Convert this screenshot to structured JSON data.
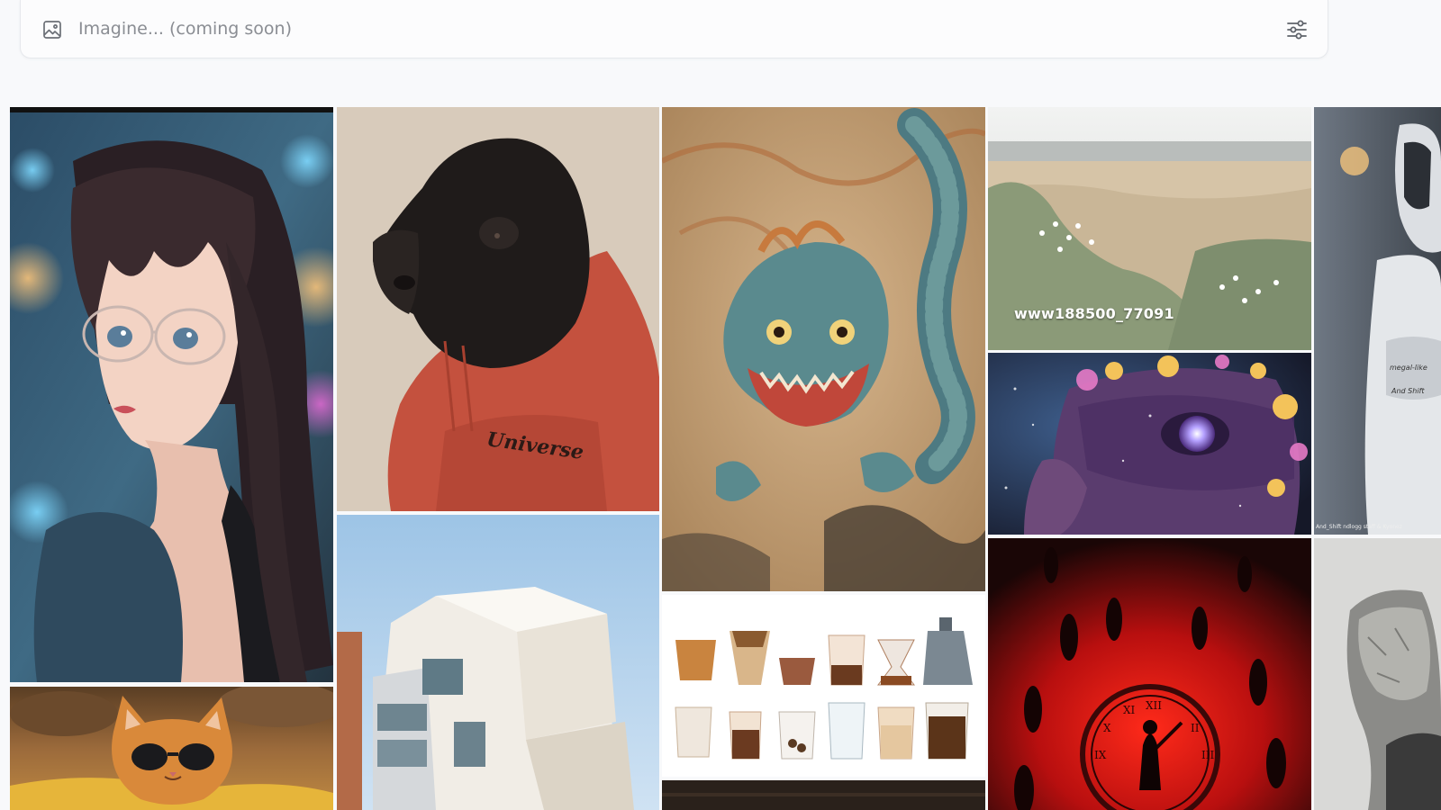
{
  "prompt": {
    "placeholder": "Imagine... (coming soon)",
    "value": "",
    "image_icon": "image-icon",
    "settings_icon": "sliders-icon"
  },
  "gallery": {
    "tiles": [
      {
        "subject": "anime-girl-glasses"
      },
      {
        "subject": "gorilla-red-hoodie",
        "text": "Universe"
      },
      {
        "subject": "blue-dragon-painting"
      },
      {
        "subject": "coastal-dunes-painting",
        "caption": "www188500_77091"
      },
      {
        "subject": "robot-armor",
        "text": "megal-like And Shift",
        "credit": "And_Shift ndlogg staff & Kyonez"
      },
      {
        "subject": "cosmic-eye-face"
      },
      {
        "subject": "red-clock-figures"
      },
      {
        "subject": "white-building"
      },
      {
        "subject": "coffee-cups-watercolor"
      },
      {
        "subject": "cat-sunglasses"
      },
      {
        "subject": "stone-head"
      },
      {
        "subject": "dark-wood"
      }
    ]
  },
  "colors": {
    "background": "#f8f9fb",
    "bar_border": "#e6e8ec",
    "placeholder": "#8a8d93"
  }
}
